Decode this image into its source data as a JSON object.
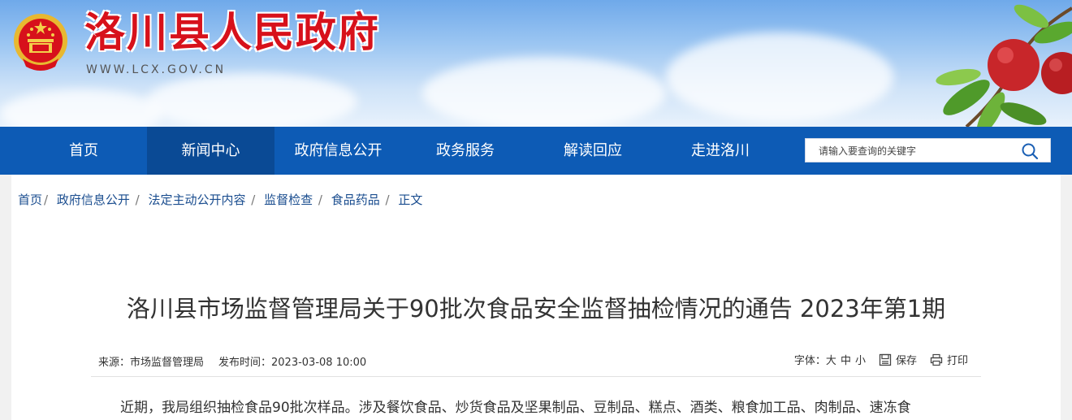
{
  "header": {
    "site_title": "洛川县人民政府",
    "site_url": "WWW.LCX.GOV.CN"
  },
  "nav": {
    "items": [
      {
        "label": "首页"
      },
      {
        "label": "新闻中心"
      },
      {
        "label": "政府信息公开"
      },
      {
        "label": "政务服务"
      },
      {
        "label": "解读回应"
      },
      {
        "label": "走进洛川"
      }
    ],
    "active_index": 1
  },
  "search": {
    "placeholder": "请输入要查询的关键字"
  },
  "breadcrumb": {
    "items": [
      "首页",
      "政府信息公开",
      "法定主动公开内容",
      "监督检查",
      "食品药品",
      "正文"
    ]
  },
  "article": {
    "title": "洛川县市场监督管理局关于90批次食品安全监督抽检情况的通告 2023年第1期",
    "source": "来源：市场监督管理局",
    "publish_time": "发布时间：2023-03-08 10:00",
    "font_size_label": "字体：",
    "size_large": "大",
    "size_medium": "中",
    "size_small": "小",
    "save_label": "保存",
    "print_label": "打印",
    "first_paragraph": "近期，我局组织抽检食品90批次样品。涉及餐饮食品、炒货食品及坚果制品、豆制品、糕点、酒类、粮食加工品、肉制品、速冻食"
  },
  "colors": {
    "brand_red": "#d7111b",
    "nav_blue": "#0d5bb5",
    "nav_active": "#0a4a95",
    "link_blue": "#1a4d8f"
  }
}
